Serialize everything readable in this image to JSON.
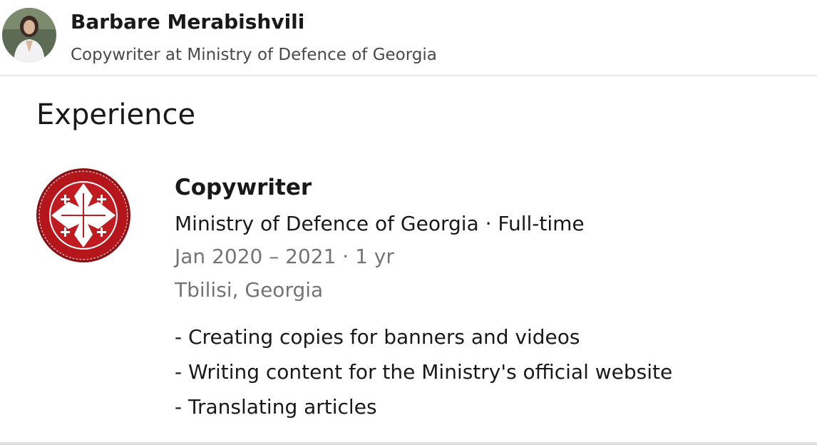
{
  "profile": {
    "name": "Barbare Merabishvili",
    "headline": "Copywriter at Ministry of Defence of Georgia",
    "avatar_icon": "avatar-photo"
  },
  "experience": {
    "section_title": "Experience",
    "items": [
      {
        "title": "Copywriter",
        "company_line": "Ministry of Defence of Georgia · Full-time",
        "dates": "Jan 2020 – 2021 · 1 yr",
        "location": "Tbilisi, Georgia",
        "logo_icon": "ministry-seal-logo",
        "description": [
          "- Creating copies for banners and videos",
          "- Writing content for the Ministry's official website",
          "- Translating articles"
        ]
      }
    ]
  },
  "colors": {
    "logo_red": "#b5161c",
    "logo_dark_red": "#8d1014"
  }
}
